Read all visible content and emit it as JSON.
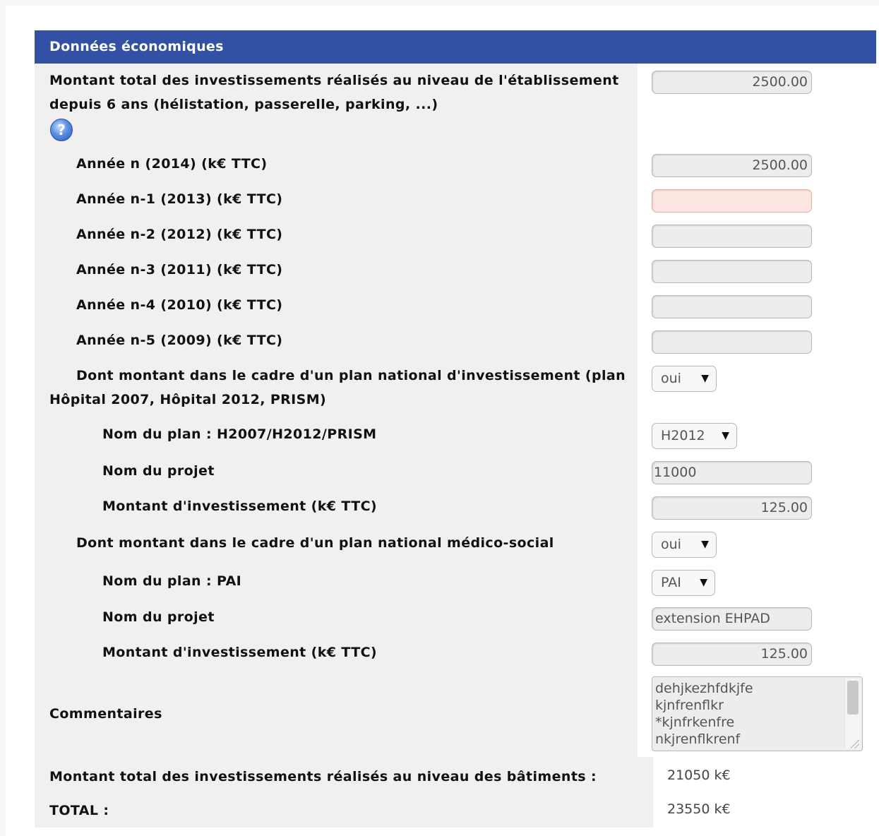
{
  "section": {
    "title": "Données économiques"
  },
  "total_invest": {
    "label": "Montant total des investissements réalisés au niveau de l'établissement depuis 6 ans (hélistation, passerelle, parking, ...)",
    "value": "2500.00",
    "help_glyph": "?"
  },
  "years": [
    {
      "label": "Année n (2014) (k€ TTC)",
      "value": "2500.00"
    },
    {
      "label": "Année n-1 (2013) (k€ TTC)",
      "value": ""
    },
    {
      "label": "Année n-2 (2012) (k€ TTC)",
      "value": ""
    },
    {
      "label": "Année n-3 (2011) (k€ TTC)",
      "value": ""
    },
    {
      "label": "Année n-4 (2010) (k€ TTC)",
      "value": ""
    },
    {
      "label": "Année n-5 (2009) (k€ TTC)",
      "value": ""
    }
  ],
  "plan_national": {
    "label": "Dont montant dans le cadre d'un plan national d'investissement (plan Hôpital 2007, Hôpital 2012, PRISM)",
    "selected": "oui",
    "plan_name_label": "Nom du plan : H2007/H2012/PRISM",
    "plan_name_selected": "H2012",
    "project_label": "Nom du projet",
    "project_value": "11000",
    "amount_label": "Montant d'investissement (k€ TTC)",
    "amount_value": "125.00"
  },
  "plan_medico": {
    "label": "Dont montant dans le cadre d'un plan national médico-social",
    "selected": "oui",
    "plan_name_label": "Nom du plan : PAI",
    "plan_name_selected": "PAI",
    "project_label": "Nom du projet",
    "project_value": "extension EHPAD",
    "amount_label": "Montant d'investissement (k€ TTC)",
    "amount_value": "125.00"
  },
  "comments": {
    "label": "Commentaires",
    "lines": [
      "dehjkezhfdkjfe",
      "kjnfrenflkr",
      "*kjnfrkenfre",
      "nkjrenflkrenf"
    ]
  },
  "summary": {
    "buildings_label": "Montant total des investissements réalisés au niveau des bâtiments :",
    "buildings_value": "21050 k€",
    "total_label": "TOTAL :",
    "total_value": "23550 k€"
  },
  "icons": {
    "dropdown": "▼"
  },
  "colors": {
    "header": "#3251a4",
    "error_field": "#fde6e2"
  }
}
